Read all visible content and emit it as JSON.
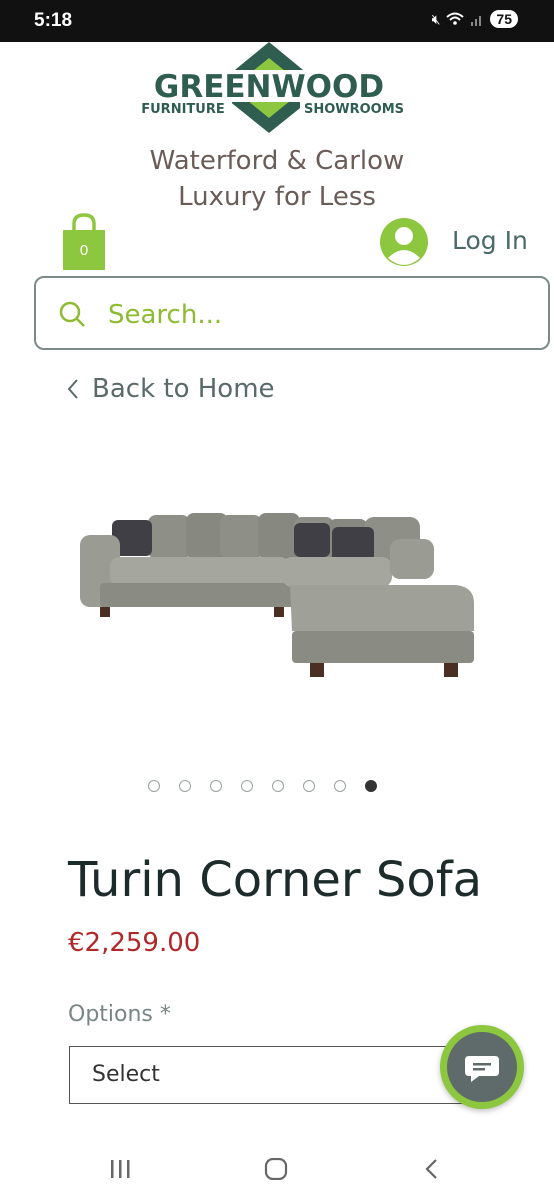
{
  "status": {
    "time": "5:18",
    "battery": "75"
  },
  "logo": {
    "name": "GREENWOOD",
    "left": "FURNITURE",
    "right": "SHOWROOMS"
  },
  "tagline": {
    "line1": "Waterford & Carlow",
    "line2": "Luxury for Less"
  },
  "cart": {
    "count": "0"
  },
  "account": {
    "login_label": "Log In"
  },
  "search": {
    "placeholder": "Search..."
  },
  "nav": {
    "back_label": "Back to Home"
  },
  "gallery": {
    "total": 8,
    "active_index": 7
  },
  "product": {
    "title": "Turin Corner Sofa",
    "price": "€2,259.00"
  },
  "options": {
    "label": "Options *",
    "selected": "Select"
  },
  "colors": {
    "accent_green": "#8dc63f",
    "brand_dark_green": "#2f5d50",
    "price_red": "#b0282a"
  }
}
